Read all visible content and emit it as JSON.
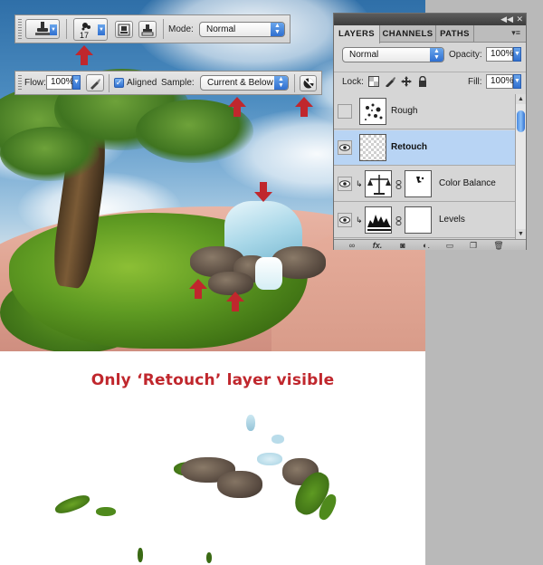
{
  "toolbar_top": {
    "brush_size": "17",
    "mode_label": "Mode:",
    "mode_value": "Normal"
  },
  "toolbar_options": {
    "flow_label": "Flow:",
    "flow_value": "100%",
    "aligned_label": "Aligned",
    "sample_label": "Sample:",
    "sample_value": "Current & Below"
  },
  "layers_panel": {
    "tabs": [
      {
        "label": "LAYERS",
        "active": true
      },
      {
        "label": "CHANNELS",
        "active": false
      },
      {
        "label": "PATHS",
        "active": false
      }
    ],
    "blend_mode": "Normal",
    "opacity_label": "Opacity:",
    "opacity_value": "100%",
    "lock_label": "Lock:",
    "fill_label": "Fill:",
    "fill_value": "100%",
    "layers": [
      {
        "name": "Rough",
        "visible": false,
        "selected": false
      },
      {
        "name": "Retouch",
        "visible": true,
        "selected": true
      },
      {
        "name": "Color Balance",
        "visible": true,
        "selected": false
      },
      {
        "name": "Levels",
        "visible": true,
        "selected": false
      }
    ]
  },
  "caption": "Only ‘Retouch’ layer visible",
  "colors": {
    "accent_red": "#c0272d",
    "selection_blue": "#b8d4f4",
    "control_blue": "#2f6fd0"
  }
}
